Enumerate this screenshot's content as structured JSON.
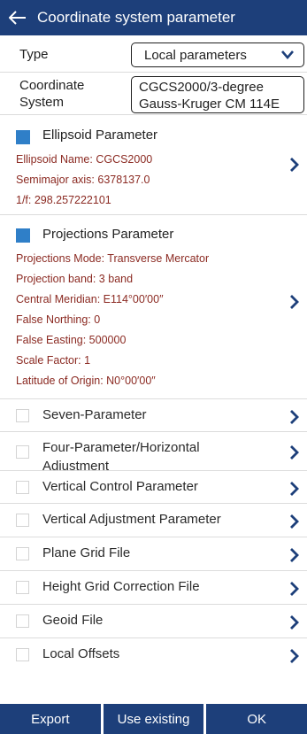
{
  "header": {
    "title": "Coordinate system parameter"
  },
  "type_row": {
    "label": "Type",
    "value": "Local parameters"
  },
  "cs_row": {
    "label": "Coordinate System",
    "value": "CGCS2000/3-degree Gauss-Kruger CM 114E"
  },
  "ellipsoid": {
    "title": "Ellipsoid Parameter",
    "checked": true,
    "lines": [
      "Ellipsoid Name: CGCS2000",
      "Semimajor axis: 6378137.0",
      "1/f: 298.257222101"
    ]
  },
  "projections": {
    "title": "Projections Parameter",
    "checked": true,
    "lines": [
      "Projections Mode: Transverse Mercator",
      "Projection band: 3 band",
      "Central Meridian: E114°00′00″",
      "False Northing: 0",
      "False Easting: 500000",
      "Scale Factor: 1",
      "Latitude of Origin: N0°00′00″"
    ]
  },
  "items": [
    "Seven-Parameter",
    "Four-Parameter/Horizontal Adjustment",
    "Vertical Control Parameter",
    "Vertical Adjustment Parameter",
    "Plane Grid File",
    "Height Grid Correction File",
    "Geoid File",
    "Local Offsets"
  ],
  "footer": {
    "export": "Export",
    "use_existing": "Use existing",
    "ok": "OK"
  },
  "colors": {
    "header": "#1d3f7a",
    "checkbox": "#2f7fc8",
    "detail_text": "#8b2a22",
    "arrow": "#1d3f7a"
  }
}
